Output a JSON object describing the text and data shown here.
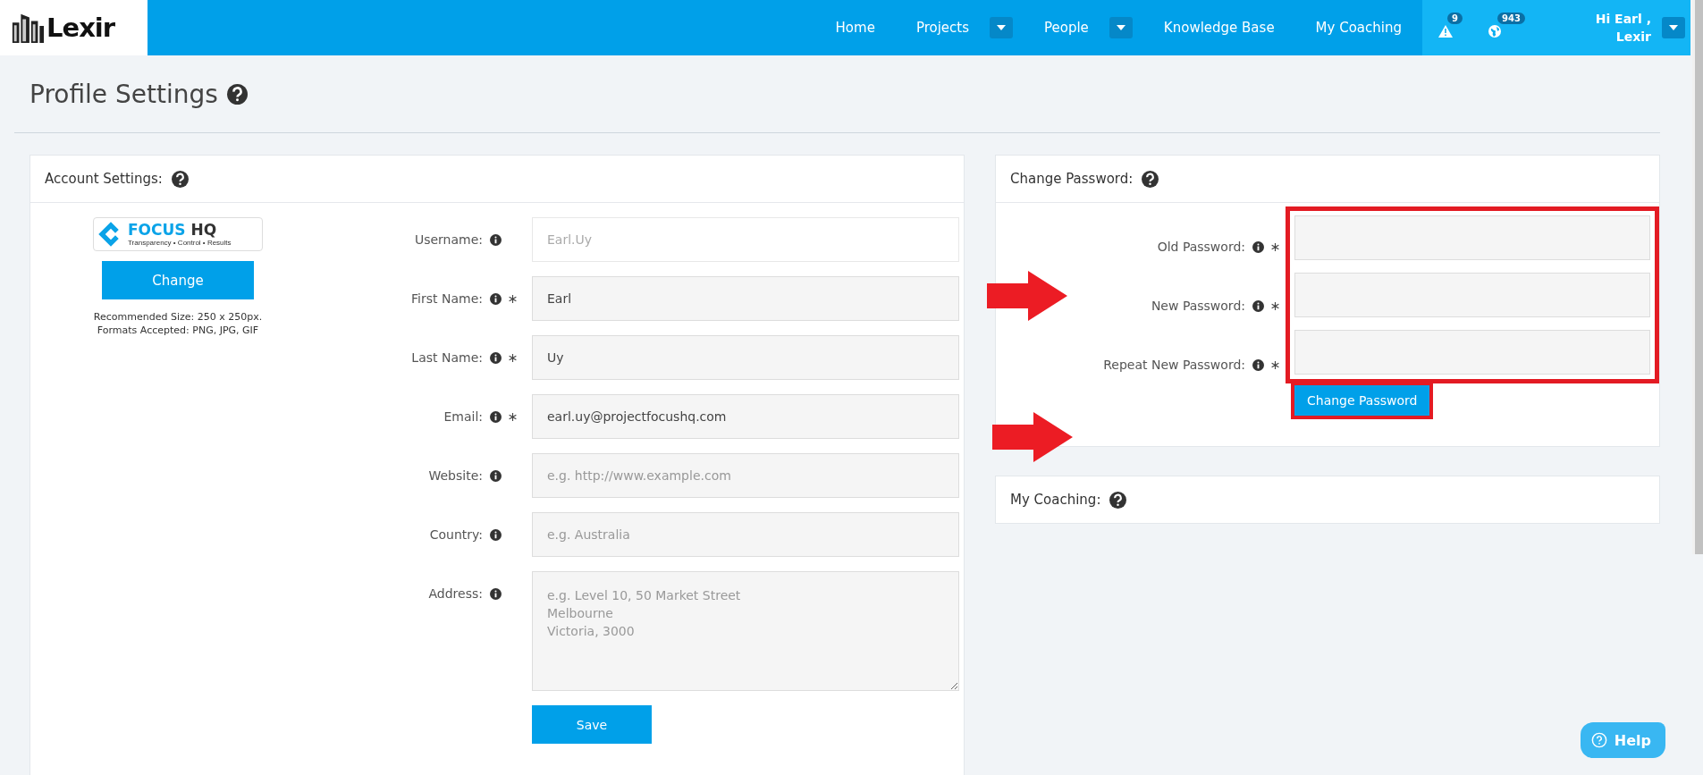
{
  "header": {
    "logo": "Lexir",
    "nav": [
      {
        "label": "Home",
        "dropdown": false
      },
      {
        "label": "Projects",
        "dropdown": true
      },
      {
        "label": "People",
        "dropdown": true
      },
      {
        "label": "Knowledge Base",
        "dropdown": false
      },
      {
        "label": "My Coaching",
        "dropdown": false
      }
    ],
    "alerts": {
      "count": "9"
    },
    "notifications": {
      "count": "943"
    },
    "user": {
      "greeting": "Hi Earl ,",
      "name": "Lexir"
    }
  },
  "page_title": "Profile Settings",
  "account": {
    "title": "Account Settings:",
    "logo": {
      "brand": "FOCUS",
      "brand_suffix": "HQ",
      "tagline": "Transparency • Control • Results"
    },
    "change_button": "Change",
    "hint": [
      "Recommended Size: 250 x 250px.",
      "Formats Accepted: PNG, JPG, GIF"
    ],
    "fields": [
      {
        "label": "Username:",
        "kind": "text",
        "required": false,
        "disabled": true,
        "value": "Earl.Uy"
      },
      {
        "label": "First Name:",
        "kind": "text",
        "required": true,
        "disabled": false,
        "value": "Earl"
      },
      {
        "label": "Last Name:",
        "kind": "text",
        "required": true,
        "disabled": false,
        "value": "Uy"
      },
      {
        "label": "Email:",
        "kind": "text",
        "required": true,
        "disabled": false,
        "value": "earl.uy@projectfocushq.com"
      },
      {
        "label": "Website:",
        "kind": "text",
        "required": false,
        "disabled": false,
        "placeholder": "e.g. http://www.example.com"
      },
      {
        "label": "Country:",
        "kind": "text",
        "required": false,
        "disabled": false,
        "placeholder": "e.g. Australia"
      },
      {
        "label": "Address:",
        "kind": "textarea",
        "required": false,
        "disabled": false,
        "placeholder": "e.g. Level 10, 50 Market Street\nMelbourne\nVictoria, 3000"
      }
    ],
    "save_button": "Save"
  },
  "password": {
    "title": "Change Password:",
    "fields": [
      {
        "label": "Old Password:",
        "required": true
      },
      {
        "label": "New Password:",
        "required": true
      },
      {
        "label": "Repeat New Password:",
        "required": true
      }
    ],
    "button": "Change Password"
  },
  "coaching": {
    "title": "My Coaching:"
  },
  "help_button": "Help"
}
